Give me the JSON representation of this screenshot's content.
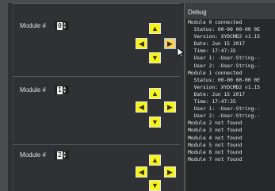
{
  "modules": [
    {
      "label": "Module #",
      "value": "0"
    },
    {
      "label": "Module #",
      "value": "1"
    },
    {
      "label": "Module #",
      "value": "2"
    }
  ],
  "icons": {
    "up": "arrow-up-icon",
    "down": "arrow-down-icon",
    "left": "arrow-left-icon",
    "right": "arrow-right-icon"
  },
  "colors": {
    "button_yellow": "#f6f41a",
    "button_active": "#ffd34d",
    "background": "#2f3134"
  },
  "debug": {
    "title": "Debug",
    "lines": [
      "Module 0 connected",
      "  Status: 00-00 00-00 0E",
      "  Version: XYDCMD2 v1.15",
      "  Date: Jun 15 2017",
      "  Time: 17:47:35",
      "  User 1: -User-String--",
      "  User 2: -User-String--",
      "Module 1 connected",
      "  Status: 00-00 00-00 0E",
      "  Version: XYDCMD2 v1.15",
      "  Date: Jun 15 2017",
      "  Time: 17:47:35",
      "  User 1: -User-String--",
      "  User 2: -User-String--",
      "Module 2 not found",
      "Module 3 not found",
      "Module 4 not found",
      "Module 5 not found",
      "Module 6 not found",
      "Module 7 not found"
    ]
  }
}
